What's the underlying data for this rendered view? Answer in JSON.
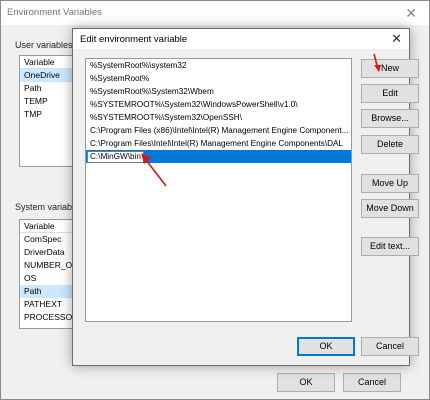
{
  "bg_window": {
    "title": "Environment Variables",
    "user_group_label": "User variables fo",
    "user_list": {
      "header": "Variable",
      "rows": [
        "OneDrive",
        "Path",
        "TEMP",
        "TMP"
      ]
    },
    "system_group_label": "System variable",
    "system_list": {
      "header": "Variable",
      "rows": [
        "ComSpec",
        "DriverData",
        "NUMBER_OF_",
        "OS",
        "Path",
        "PATHEXT",
        "PROCESSOR"
      ]
    },
    "ok_label": "OK",
    "cancel_label": "Cancel"
  },
  "dialog": {
    "title": "Edit environment variable",
    "paths": [
      "%SystemRoot%\\system32",
      "%SystemRoot%",
      "%SystemRoot%\\System32\\Wbem",
      "%SYSTEMROOT%\\System32\\WindowsPowerShell\\v1.0\\",
      "%SYSTEMROOT%\\System32\\OpenSSH\\",
      "C:\\Program Files (x86)\\Intel\\Intel(R) Management Engine Component...",
      "C:\\Program Files\\Intel\\Intel(R) Management Engine Components\\DAL",
      "C:\\MinGW\\bin"
    ],
    "buttons": {
      "new": "New",
      "edit": "Edit",
      "browse": "Browse...",
      "delete": "Delete",
      "move_up": "Move Up",
      "move_down": "Move Down",
      "edit_text": "Edit text...",
      "ok": "OK",
      "cancel": "Cancel"
    }
  },
  "colors": {
    "selection": "#0078d7",
    "annotation_arrow": "#d11a1a"
  }
}
